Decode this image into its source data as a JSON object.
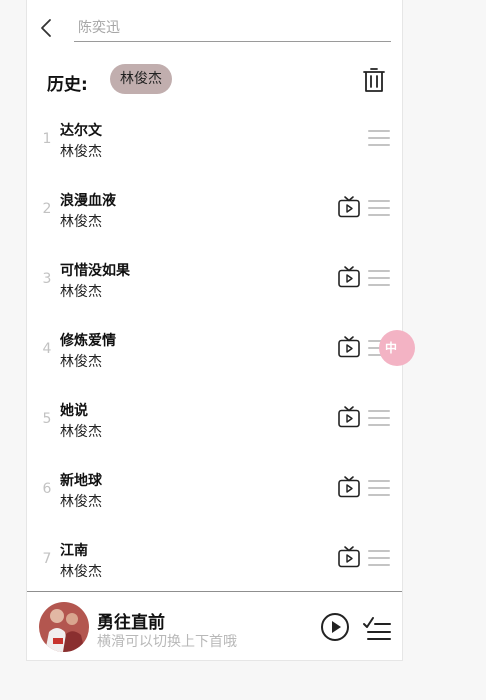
{
  "search": {
    "placeholder": "陈奕迅",
    "value": ""
  },
  "history": {
    "title": "历史:",
    "items": [
      "林俊杰"
    ]
  },
  "songs": [
    {
      "index": "1",
      "title": "达尔文",
      "artist": "林俊杰",
      "has_mv": false
    },
    {
      "index": "2",
      "title": "浪漫血液",
      "artist": "林俊杰",
      "has_mv": true
    },
    {
      "index": "3",
      "title": "可惜没如果",
      "artist": "林俊杰",
      "has_mv": true
    },
    {
      "index": "4",
      "title": "修炼爱情",
      "artist": "林俊杰",
      "has_mv": true
    },
    {
      "index": "5",
      "title": "她说",
      "artist": "林俊杰",
      "has_mv": true
    },
    {
      "index": "6",
      "title": "新地球",
      "artist": "林俊杰",
      "has_mv": true
    },
    {
      "index": "7",
      "title": "江南",
      "artist": "林俊杰",
      "has_mv": true
    }
  ],
  "float_badge": {
    "text": "中",
    "color": "#f3b3c4"
  },
  "player": {
    "title": "勇往直前",
    "hint": "横滑可以切换上下首哦"
  },
  "icons": {
    "back": "chevron-left-icon",
    "trash": "trash-icon",
    "mv": "tv-play-icon",
    "menu": "hamburger-menu-icon",
    "play": "play-circle-icon",
    "queue": "playlist-icon"
  },
  "colors": {
    "chip_bg": "#c1aeae",
    "index_gray": "#c2c2c2",
    "hint_gray": "#b8b8b8"
  }
}
